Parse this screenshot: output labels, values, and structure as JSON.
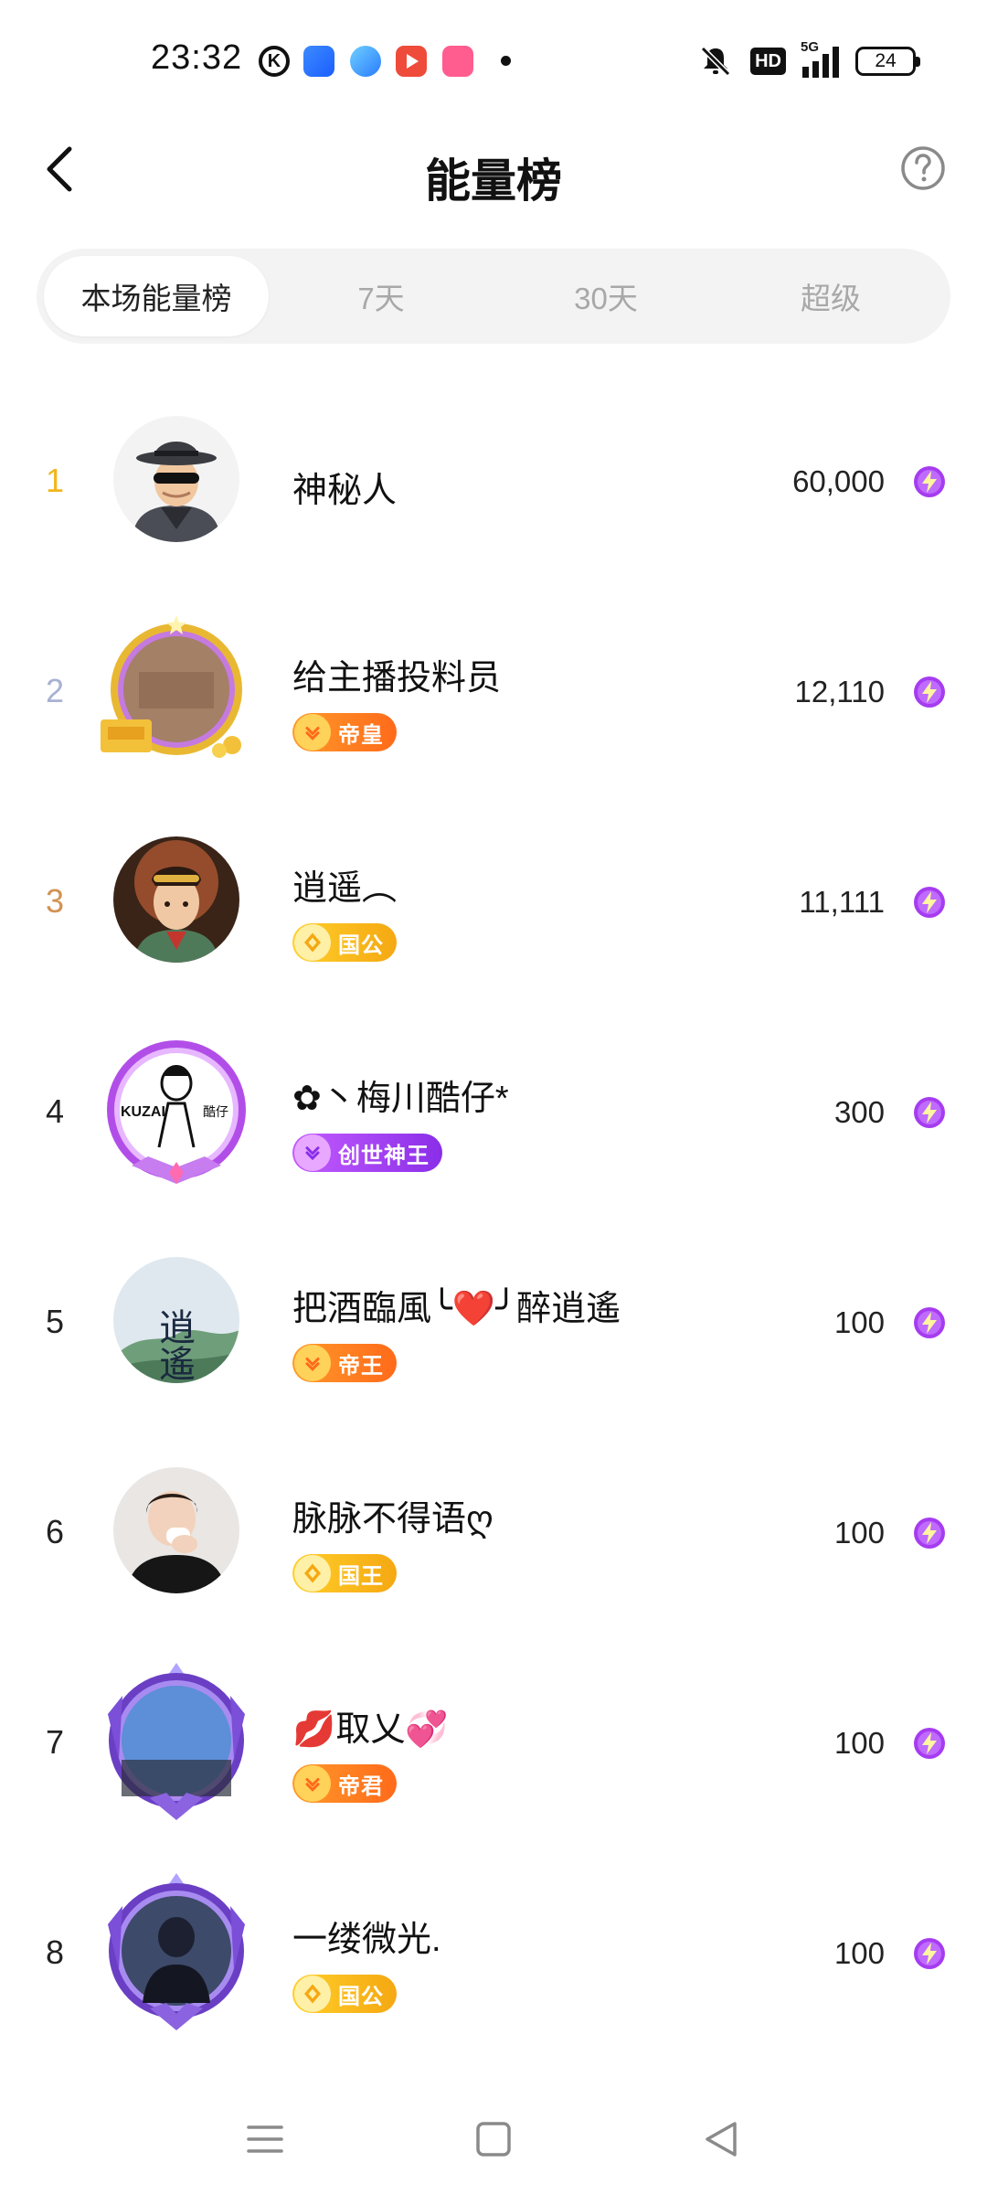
{
  "status_bar": {
    "time": "23:32",
    "notif_k_glyph": "K",
    "hd_label": "HD",
    "network_label": "5G",
    "battery_level": "24"
  },
  "header": {
    "title": "能量榜",
    "back_icon": "chevron-left-icon",
    "help_icon": "question-circle-icon"
  },
  "tabs": [
    {
      "label": "本场能量榜",
      "active": true
    },
    {
      "label": "7天",
      "active": false
    },
    {
      "label": "30天",
      "active": false
    },
    {
      "label": "超级",
      "active": false
    }
  ],
  "ranking": [
    {
      "rank": "1",
      "name": "神秘人",
      "badge": "",
      "score": "60,000"
    },
    {
      "rank": "2",
      "name": "给主播投料员",
      "badge": "帝皇",
      "score": "12,110"
    },
    {
      "rank": "3",
      "name": "逍遥︵",
      "badge": "国公",
      "score": "11,111"
    },
    {
      "rank": "4",
      "name": "✿丶梅川酷仔*",
      "badge": "创世神王",
      "score": "300"
    },
    {
      "rank": "5",
      "name": "把酒臨風╰❤️╯醉逍遙",
      "badge": "帝王",
      "score": "100"
    },
    {
      "rank": "6",
      "name": "脉脉不得语ღ",
      "badge": "国王",
      "score": "100"
    },
    {
      "rank": "7",
      "name": "💋取乂💞",
      "badge": "帝君",
      "score": "100"
    },
    {
      "rank": "8",
      "name": "一缕微光.",
      "badge": "国公",
      "score": "100"
    }
  ],
  "avatar_4_text": "KUZAI",
  "avatar_4_sub": "酷仔",
  "avatar_5_text": "逍遙",
  "colors": {
    "rank1": "#f2b51c",
    "rank2": "#a9b1d3",
    "rank3": "#d29253",
    "energy": "#a63cf0",
    "tab_bg": "#f3f3f3"
  },
  "navbar": {
    "menu_icon": "menu-icon",
    "home_icon": "square-home-icon",
    "back_icon": "triangle-back-icon"
  }
}
